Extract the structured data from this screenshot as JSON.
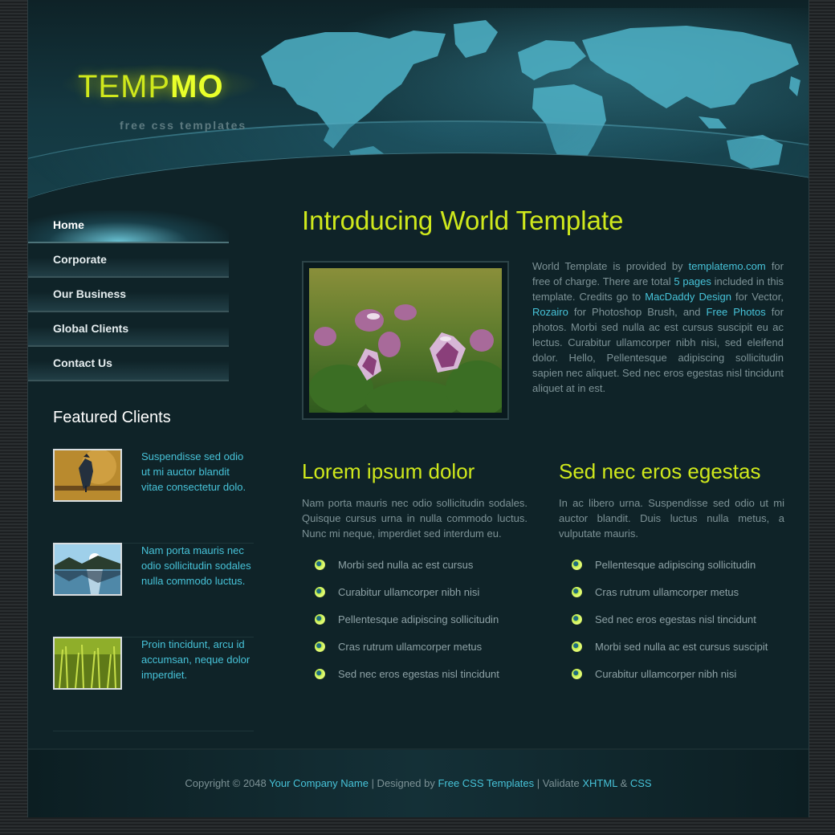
{
  "header": {
    "logo_part1": "TEMP",
    "logo_part2": "MO",
    "tagline": "free css templates"
  },
  "menu": [
    {
      "label": "Home",
      "active": true
    },
    {
      "label": "Corporate"
    },
    {
      "label": "Our Business"
    },
    {
      "label": "Global Clients"
    },
    {
      "label": "Contact Us"
    }
  ],
  "featured": {
    "title": "Featured Clients",
    "clients": [
      {
        "text": "Suspendisse sed odio ut mi auctor blandit vitae consectetur dolo.",
        "image": "bird-photo"
      },
      {
        "text": "Nam porta mauris nec odio sollicitudin sodales nulla commodo luctus.",
        "image": "lake-photo"
      },
      {
        "text": "Proin tincidunt, arcu id accumsan, neque dolor imperdiet.",
        "image": "grass-photo"
      }
    ]
  },
  "main": {
    "title": "Introducing World Template",
    "intro": {
      "t1": "World Template is provided by ",
      "link1": "templatemo.com",
      "t2": " for free of charge. There are total ",
      "link2": "5 pages",
      "t3": " included in this template. Credits go to ",
      "link3": "MacDaddy Design",
      "t4": " for Vector, ",
      "link4": "Rozairo",
      "t5": " for Photoshop Brush, and ",
      "link5": "Free Photos",
      "t6": " for photos. Morbi sed nulla ac est cursus suscipit eu ac lectus. Curabitur ullamcorper nibh nisi, sed eleifend dolor. Hello, Pellentesque adipiscing sollicitudin sapien nec aliquet. Sed nec eros egestas nisl tincidunt aliquet at in est."
    },
    "col1": {
      "title": "Lorem ipsum dolor",
      "text": "Nam porta mauris nec odio sollicitudin sodales. Quisque cursus urna in nulla commodo luctus. Nunc mi neque, imperdiet sed interdum eu.",
      "items": [
        "Morbi sed nulla ac est cursus",
        "Curabitur ullamcorper nibh nisi",
        "Pellentesque adipiscing sollicitudin",
        "Cras rutrum ullamcorper metus",
        "Sed nec eros egestas nisl tincidunt"
      ]
    },
    "col2": {
      "title": "Sed nec eros egestas",
      "text": "In ac libero urna. Suspendisse sed odio ut mi auctor blandit. Duis luctus nulla metus, a vulputate mauris.",
      "items": [
        "Pellentesque adipiscing sollicitudin",
        "Cras rutrum ullamcorper metus",
        "Sed nec eros egestas nisl tincidunt",
        "Morbi sed nulla ac est cursus suscipit",
        "Curabitur ullamcorper nibh nisi"
      ]
    }
  },
  "footer": {
    "t1": "Copyright © 2048 ",
    "link1": "Your Company Name",
    "t2": " | Designed by ",
    "link2": "Free CSS Templates",
    "t3": " | Validate ",
    "link3": "XHTML",
    "t4": " & ",
    "link4": "CSS"
  },
  "colors": {
    "accent": "#cfe81c",
    "link": "#47c3d9",
    "background": "#0f2328",
    "text": "#7d9296"
  }
}
